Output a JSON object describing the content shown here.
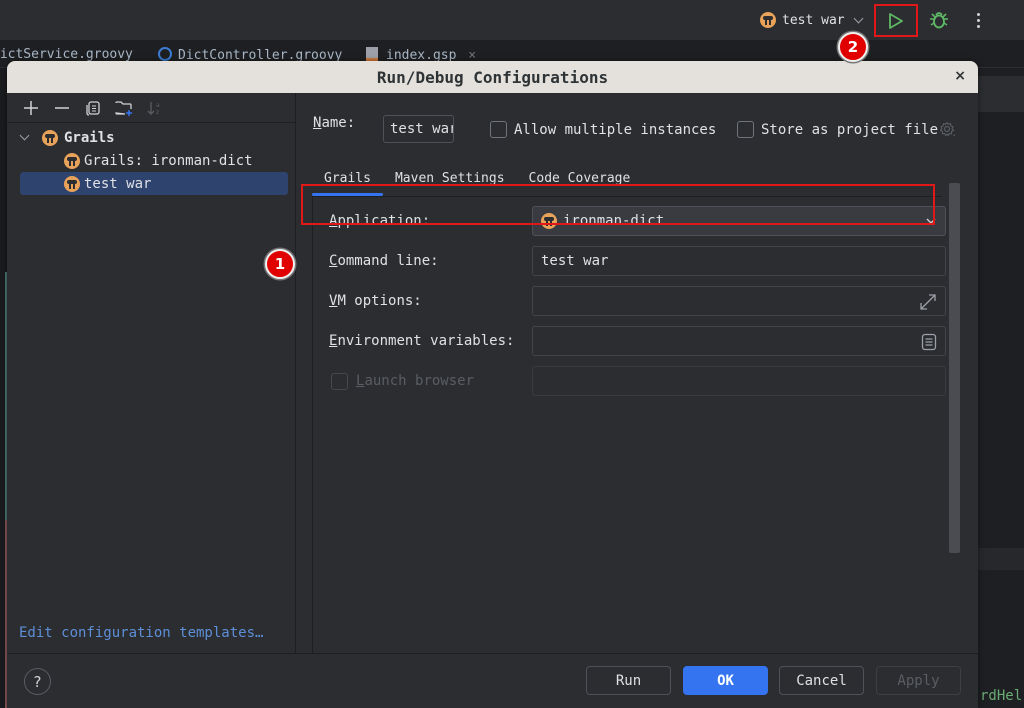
{
  "ide": {
    "tabs": [
      {
        "label": "DictService.groovy",
        "icon": "groovy-file-icon"
      },
      {
        "label": "DictController.groovy",
        "icon": "groovy-class-icon"
      },
      {
        "label": "index.gsp",
        "icon": "gsp-file-icon"
      }
    ],
    "tab_close": "×",
    "run_config": {
      "label": "test war",
      "icon": "grails-icon"
    },
    "bottom_code_text": "withScrdHe",
    "bottom_code_right": "rdHel"
  },
  "annotations": [
    {
      "number": "1",
      "target": "command-line-row"
    },
    {
      "number": "2",
      "target": "run-button"
    }
  ],
  "colors": {
    "accent": "#3574f0",
    "highlight": "#e01818",
    "badge": "#e10000",
    "grails": "#e8a25a",
    "run_green": "#5fb865",
    "link": "#5d8fd8"
  },
  "dialog": {
    "title": "Run/Debug Configurations",
    "close": "×",
    "toolbar": [
      {
        "name": "add",
        "icon": "plus-icon"
      },
      {
        "name": "remove",
        "icon": "minus-icon"
      },
      {
        "name": "copy",
        "icon": "copy-icon"
      },
      {
        "name": "new-folder",
        "icon": "folder-add-icon"
      },
      {
        "name": "sort",
        "icon": "sort-alpha-icon"
      }
    ],
    "tree": {
      "group": "Grails",
      "items": [
        {
          "label": "Grails: ironman-dict",
          "selected": false
        },
        {
          "label": "test war",
          "selected": true
        }
      ]
    },
    "edit_templates_link": "Edit configuration templates…",
    "name_label": "Name:",
    "name_value": "test war",
    "allow_multiple_label": "Allow multiple instances",
    "allow_multiple_checked": false,
    "store_project_label": "Store as project file",
    "store_project_checked": false,
    "tabs": [
      {
        "label": "Grails",
        "active": true
      },
      {
        "label": "Maven Settings",
        "active": false
      },
      {
        "label": "Code Coverage",
        "active": false
      }
    ],
    "form": {
      "application": {
        "label": "Application:",
        "value": "ironman-dict"
      },
      "command_line": {
        "label": "Command line:",
        "value": "test war"
      },
      "vm_options": {
        "label": "VM options:",
        "value": ""
      },
      "env_vars": {
        "label": "Environment variables:",
        "value": ""
      },
      "launch_browser": {
        "label": "Launch browser",
        "checked": false,
        "enabled": false,
        "value": ""
      }
    },
    "buttons": {
      "help": "?",
      "run": "Run",
      "ok": "OK",
      "cancel": "Cancel",
      "apply": "Apply"
    }
  }
}
